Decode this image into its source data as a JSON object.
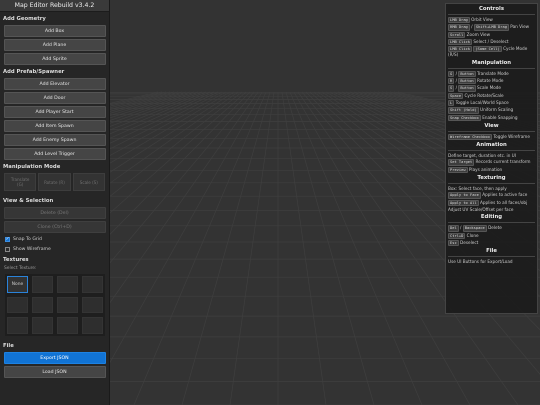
{
  "app_title": "Map Editor Rebuild v3.4.2",
  "left": {
    "add_geometry": {
      "heading": "Add Geometry",
      "buttons": [
        "Add Box",
        "Add Plane",
        "Add Sprite"
      ]
    },
    "add_prefab": {
      "heading": "Add Prefab/Spawner",
      "buttons": [
        "Add Elevator",
        "Add Door",
        "Add Player Start",
        "Add Item Spawn",
        "Add Enemy Spawn",
        "Add Level Trigger"
      ]
    },
    "manipulation_mode": {
      "heading": "Manipulation Mode",
      "buttons": [
        {
          "line1": "Translate",
          "line2": "(G)"
        },
        {
          "line1": "Rotate (R)",
          "line2": ""
        },
        {
          "line1": "Scale (S)",
          "line2": ""
        }
      ]
    },
    "view_selection": {
      "heading": "View & Selection",
      "delete_label": "Delete (Del)",
      "clone_label": "Clone (Ctrl+D)",
      "snap_label": "Snap To Grid",
      "snap_checked": true,
      "wireframe_label": "Show Wireframe",
      "wireframe_checked": false
    },
    "textures": {
      "heading": "Textures",
      "select_label": "Select Texture:",
      "none_label": "None"
    },
    "file": {
      "heading": "File",
      "export_label": "Export JSON",
      "load_label": "Load JSON"
    }
  },
  "right": {
    "controls": {
      "heading": "Controls",
      "orbit_key": "LMB Drag",
      "orbit_text": "Orbit View",
      "pan_key1": "RMB Drag",
      "pan_sep": " / ",
      "pan_key2": "Shift+LMB Drag",
      "pan_text": "Pan View",
      "zoom_key": "Scroll",
      "zoom_text": "Zoom View",
      "select_key": "LMB Click",
      "select_text": "Select / Deselect",
      "cycle_key1": "LMB Click",
      "cycle_key2": "(Same Cell)",
      "cycle_text": "Cycle Mode (R/S)"
    },
    "manipulation": {
      "heading": "Manipulation",
      "translate_key1": "G",
      "translate_key2": "Button",
      "translate_text": "Translate Mode",
      "rotate_key1": "R",
      "rotate_key2": "Button",
      "rotate_text": "Rotate Mode",
      "scale_key1": "S",
      "scale_key2": "Button",
      "scale_text": "Scale Mode",
      "space_key": "Space",
      "space_text": "Cycle Rotate/Scale",
      "l_key": "L",
      "l_text": "Toggle Local/World Space",
      "shift_key": "Shift (Hold)",
      "shift_text": "Uniform Scaling",
      "snap_key": "Snap Checkbox",
      "snap_text": "Enable Snapping"
    },
    "view": {
      "heading": "View",
      "wire_key": "Wireframe Checkbox",
      "wire_text": "Toggle Wireframe"
    },
    "animation": {
      "heading": "Animation",
      "define_text": "Define target, duration etc. in UI",
      "set_key": "Set Target",
      "set_text": "Records current transform",
      "preview_key": "Preview",
      "preview_text": "Plays animation"
    },
    "texturing": {
      "heading": "Texturing",
      "box_text": "Box: Select face, then apply",
      "face_key": "Apply to Face",
      "face_text": "Applies to active face",
      "all_key": "Apply to All",
      "all_text": "Applies to all faces/obj",
      "uv_text": "Adjust UV Scale/Offset per face"
    },
    "editing": {
      "heading": "Editing",
      "del_key1": "Del",
      "del_key2": "Backspace",
      "del_text": "Delete",
      "clone_key": "Ctrl+D",
      "clone_text": "Clone",
      "esc_key": "Esc",
      "esc_text": "Deselect"
    },
    "file": {
      "heading": "File",
      "text": "Use UI Buttons for Export/Load"
    }
  },
  "colors": {
    "viewport_bg": "#333333",
    "panel_bg": "#262626",
    "accent": "#1173d4",
    "grid_line": "#3f3f3f"
  }
}
